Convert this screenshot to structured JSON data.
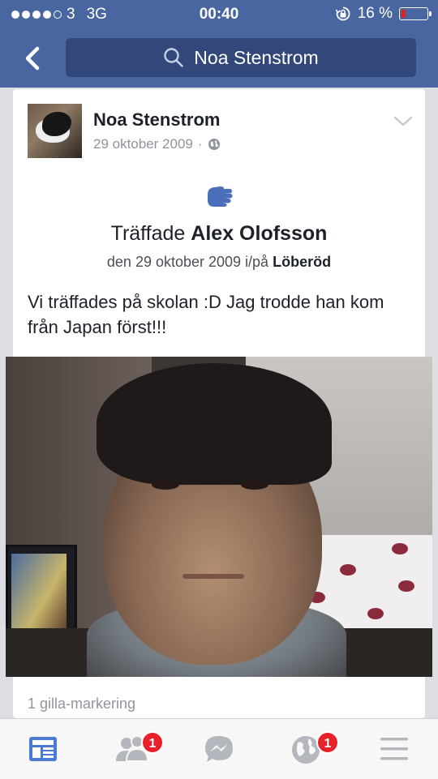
{
  "status_bar": {
    "carrier": "3",
    "network": "3G",
    "time": "00:40",
    "battery_percent": "16 %",
    "battery_level": 0.16,
    "signal_bars_filled": 4,
    "signal_bars_total": 5
  },
  "nav": {
    "back_icon": "chevron-left-icon",
    "search_icon": "search-icon",
    "search_value": "Noa Stenstrom"
  },
  "post": {
    "author": "Noa Stenstrom",
    "date": "29 oktober 2009",
    "separator": "·",
    "privacy_icon": "globe-icon",
    "menu_icon": "chevron-down-icon",
    "checkin": {
      "icon": "hand-wave-icon",
      "title_prefix": "Träffade",
      "title_name": "Alex Olofsson",
      "sub_prefix": "den 29 oktober 2009 i/på",
      "sub_place": "Löberöd"
    },
    "text": "Vi träffades på skolan :D Jag trodde han kom från Japan först!!!",
    "likes": "1 gilla-markering"
  },
  "tabbar": {
    "items": [
      {
        "name": "news-feed-icon",
        "badge": ""
      },
      {
        "name": "friend-requests-icon",
        "badge": "1"
      },
      {
        "name": "messenger-icon",
        "badge": ""
      },
      {
        "name": "notifications-globe-icon",
        "badge": "1"
      },
      {
        "name": "menu-icon",
        "badge": ""
      }
    ]
  },
  "colors": {
    "brand_blue": "#4a66a0",
    "search_bg": "#32477a",
    "badge_red": "#e8202a",
    "active_tab": "#4a7ad6",
    "inactive_tab": "#b4b7bd"
  }
}
